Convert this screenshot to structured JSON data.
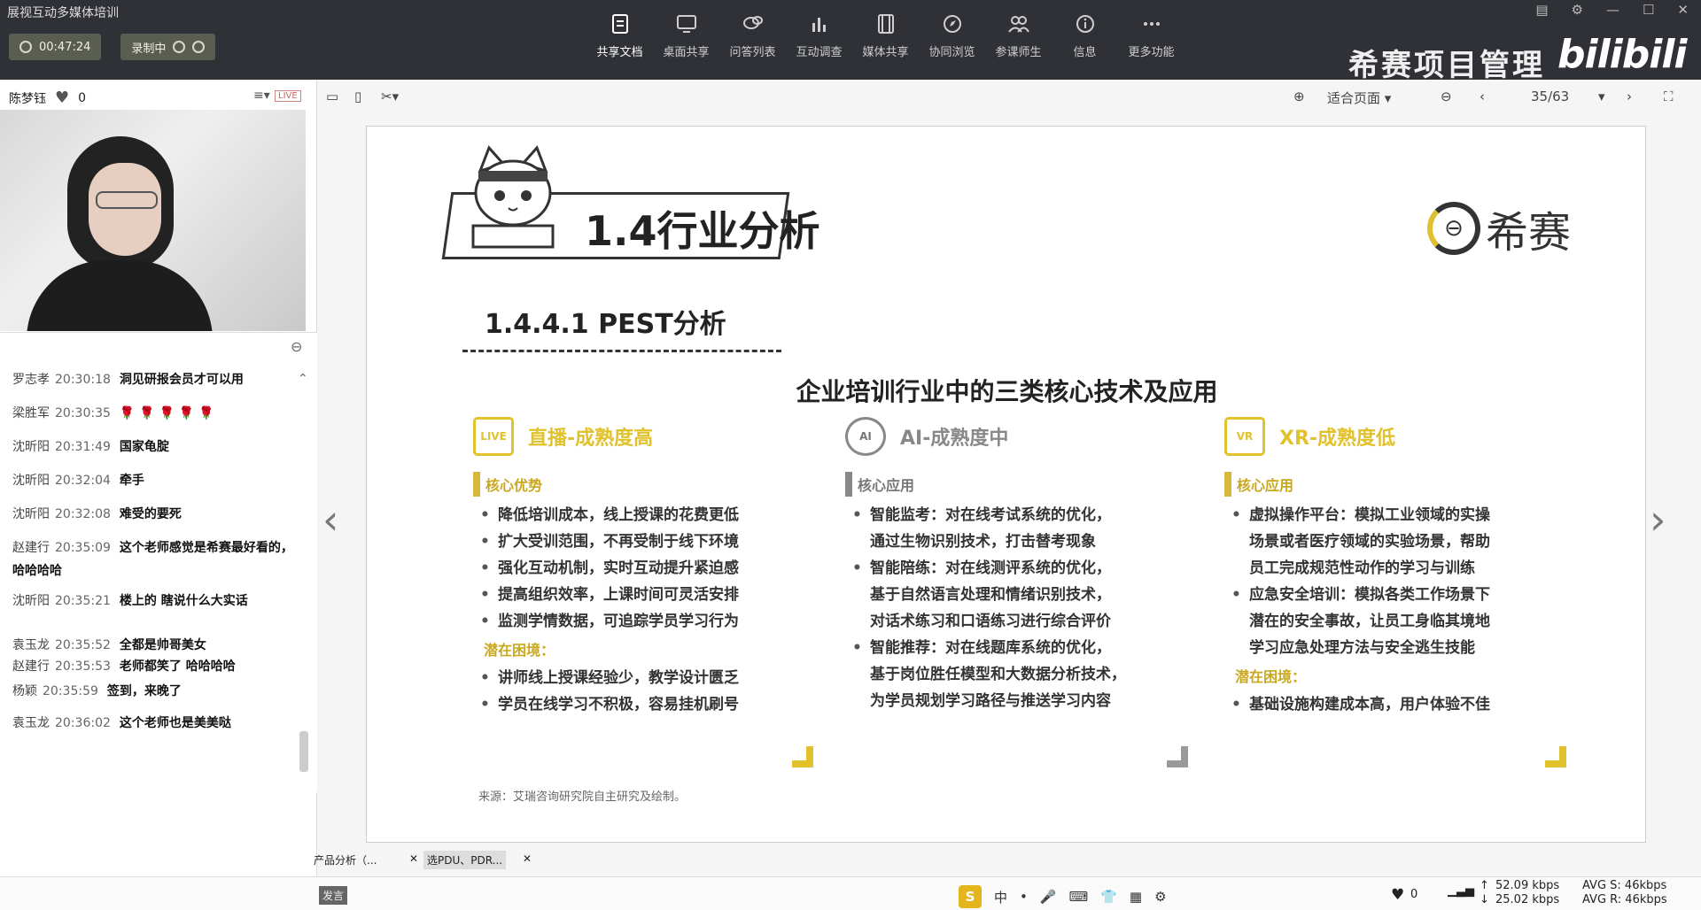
{
  "app": {
    "title": "展视互动多媒体培训"
  },
  "session": {
    "timer": "00:47:24",
    "record_label": "录制中"
  },
  "toolbar": [
    {
      "label": "共享文档",
      "icon": "document-share-icon",
      "active": true
    },
    {
      "label": "桌面共享",
      "icon": "desktop-share-icon",
      "active": false
    },
    {
      "label": "问答列表",
      "icon": "qa-list-icon",
      "active": false
    },
    {
      "label": "互动调查",
      "icon": "survey-chart-icon",
      "active": false
    },
    {
      "label": "媒体共享",
      "icon": "media-share-icon",
      "active": false
    },
    {
      "label": "协同浏览",
      "icon": "compass-icon",
      "active": false
    },
    {
      "label": "参课师生",
      "icon": "people-icon",
      "active": false
    },
    {
      "label": "信息",
      "icon": "info-icon",
      "active": false
    },
    {
      "label": "更多功能",
      "icon": "more-dots-icon",
      "active": false
    }
  ],
  "watermark": {
    "brand": "希赛项目管理",
    "site": "bilibili"
  },
  "presenter": {
    "name": "陈梦钰",
    "likes": "0",
    "live_badge": "LIVE"
  },
  "chat": [
    {
      "name": "罗志孝",
      "time": "20:30:18",
      "text": "洞见研报会员才可以用"
    },
    {
      "name": "梁胜军",
      "time": "20:30:35",
      "text": "🌹 🌹 🌹 🌹 🌹"
    },
    {
      "name": "沈昕阳",
      "time": "20:31:49",
      "text": "国家龟腚"
    },
    {
      "name": "沈昕阳",
      "time": "20:32:04",
      "text": "牵手"
    },
    {
      "name": "沈昕阳",
      "time": "20:32:08",
      "text": "难受的要死"
    },
    {
      "name": "赵建行",
      "time": "20:35:09",
      "text": "这个老师感觉是希赛最好看的，哈哈哈哈"
    },
    {
      "name": "沈昕阳",
      "time": "20:35:21",
      "text": "楼上的 瞎说什么大实话"
    },
    {
      "name": "袁玉龙",
      "time": "20:35:52",
      "text": "全都是帅哥美女"
    },
    {
      "name": "赵建行",
      "time": "20:35:53",
      "text": "老师都笑了 哈哈哈哈"
    },
    {
      "name": "杨颖",
      "time": "20:35:59",
      "text": "签到，来晚了"
    },
    {
      "name": "袁玉龙",
      "time": "20:36:02",
      "text": "这个老师也是美美哒"
    }
  ],
  "viewer": {
    "fit_label": "适合页面",
    "page": "35/63"
  },
  "slide": {
    "section": "1.4行业分析",
    "logo_text": "希赛",
    "subsection": "1.4.4.1 PEST分析",
    "heading": "企业培训行业中的三类核心技术及应用",
    "columns": [
      {
        "icon": "LIVE",
        "title": "直播-成熟度高",
        "tag": "核心优势",
        "items": [
          "降低培训成本，线上授课的花费更低",
          "扩大受训范围，不再受制于线下环境",
          "强化互动机制，实时互动提升紧迫感",
          "提高组织效率，上课时间可灵活安排",
          "监测学情数据，可追踪学员学习行为"
        ],
        "risk_label": "潜在困境：",
        "risks": [
          "讲师线上授课经验少，教学设计匮乏",
          "学员在线学习不积极，容易挂机刷号"
        ]
      },
      {
        "icon": "AI",
        "title": "AI-成熟度中",
        "tag": "核心应用",
        "items": [
          "智能监考：对在线考试系统的优化，",
          "通过生物识别技术，打击替考现象",
          "智能陪练：对在线测评系统的优化，",
          "基于自然语言处理和情绪识别技术，",
          "对话术练习和口语练习进行综合评价",
          "智能推荐：对在线题库系统的优化，",
          "基于岗位胜任模型和大数据分析技术，",
          "为学员规划学习路径与推送学习内容"
        ],
        "risk_label": "",
        "risks": []
      },
      {
        "icon": "VR",
        "title": "XR-成熟度低",
        "tag": "核心应用",
        "items": [
          "虚拟操作平台：模拟工业领域的实操",
          "场景或者医疗领域的实验场景，帮助",
          "员工完成规范性动作的学习与训练",
          "应急安全培训：模拟各类工作场景下",
          "潜在的安全事故，让员工身临其境地",
          "学习应急处理方法与安全逃生技能"
        ],
        "risk_label": "潜在困境：",
        "risks": [
          "基础设施构建成本高，用户体验不佳"
        ]
      }
    ],
    "source": "来源：艾瑞咨询研究院自主研究及绘制。"
  },
  "bottom": {
    "tab1": "产品分析（...",
    "tab2": "选PDU、PDR...",
    "send": "发言",
    "likes": "0",
    "up_rate": "52.09 kbps",
    "down_rate": "25.02 kbps",
    "avg_s": "AVG S: 46kbps",
    "avg_r": "AVG R: 46kbps",
    "ime": "中"
  },
  "colors": {
    "accent": "#e2c22c",
    "topbar": "#2f3136"
  }
}
